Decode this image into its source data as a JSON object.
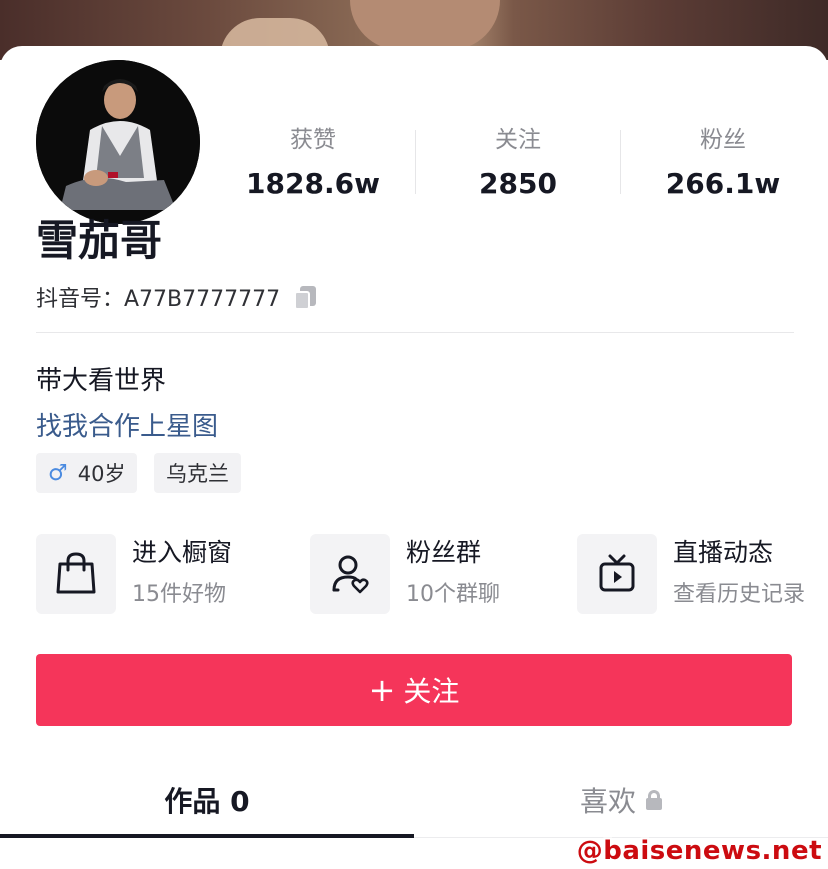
{
  "profile": {
    "stats": [
      {
        "label": "获赞",
        "value": "1828.6w"
      },
      {
        "label": "关注",
        "value": "2850"
      },
      {
        "label": "粉丝",
        "value": "266.1w"
      }
    ],
    "name": "雪茄哥",
    "douyin_id": "抖音号：A77B7777777",
    "bio": "带大看世界",
    "bio_link": "找我合作上星图",
    "tags": [
      {
        "icon": "male-icon",
        "label": "40岁"
      },
      {
        "label": "乌克兰"
      }
    ]
  },
  "functions": [
    {
      "icon": "shopping-bag-icon",
      "title": "进入橱窗",
      "subtitle": "15件好物"
    },
    {
      "icon": "fan-group-icon",
      "title": "粉丝群",
      "subtitle": "10个群聊"
    },
    {
      "icon": "live-tv-icon",
      "title": "直播动态",
      "subtitle": "查看历史记录"
    }
  ],
  "follow_button": {
    "label": "关注"
  },
  "tabs": [
    {
      "label": "作品 0"
    },
    {
      "label": "喜欢",
      "icon": "lock-icon"
    }
  ],
  "watermark": "@baisenews.net",
  "colors": {
    "accent": "#f5355a",
    "link": "#3a5b8c",
    "male": "#4b8be0",
    "watermark": "#cc0b10"
  }
}
